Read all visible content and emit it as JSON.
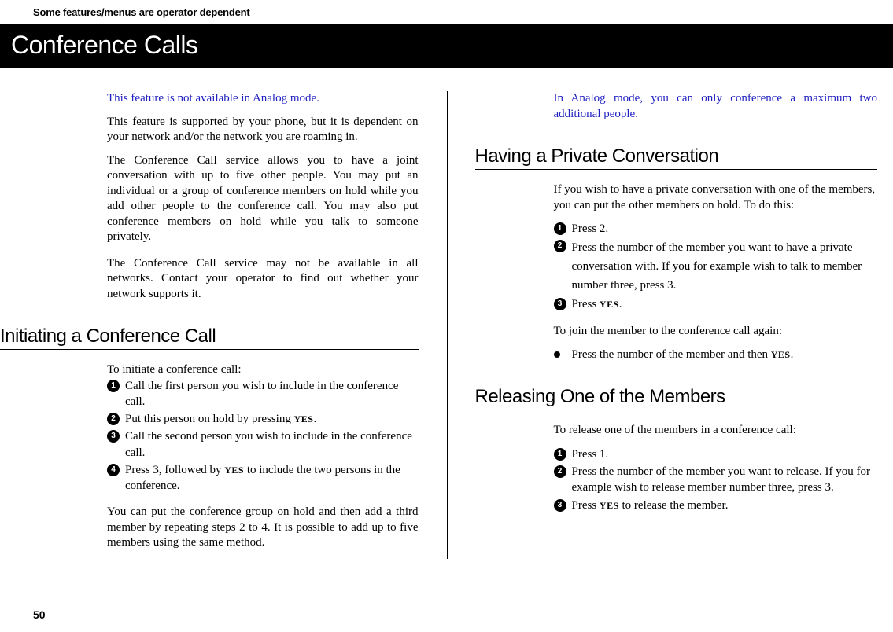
{
  "header_note": "Some features/menus are operator dependent",
  "title": "Conference Calls",
  "left": {
    "note1": "This feature is not available in Analog mode.",
    "para1": "This feature is supported by your phone, but it is dependent on your network and/or the network you are roaming in.",
    "para2": "The Conference Call service allows you to have a joint conversation with up to five other people. You may put an individual or a group of conference members on hold while you add other people to the conference call. You may also put conference members on hold while you talk to someone privately.",
    "para3": "The Conference Call service may not be available in all networks. Contact your operator to find out whether your network supports it.",
    "section1_title": "Initiating a Conference Call",
    "section1_intro": "To initiate a conference call:",
    "section1_steps": [
      "Call the first person you wish to include in the conference call.",
      "Put this person on hold by pressing ",
      "Call the second person you wish to include in the conference call.",
      "Press 3, followed by "
    ],
    "section1_step2_suffix": ".",
    "section1_step4_mid": " to include the two persons in the conference.",
    "section1_after": "You can put the conference group on hold and then add a third member by repeating steps 2 to 4. It is possible to add up to five members using the same method."
  },
  "right": {
    "note1": "In Analog mode, you can only conference a maximum two additional people.",
    "section1_title": "Having a Private Conversation",
    "section1_intro": "If you wish to have a private conversation with one of the members, you can put the other members on hold. To do this:",
    "section1_steps": [
      "Press 2.",
      "Press the number of the member you  want to have a private conversation with. If you for example wish to talk to member number three, press 3.",
      "Press "
    ],
    "section1_step3_suffix": ".",
    "section1_rejoin_intro": "To join the member to the conference call again:",
    "section1_rejoin_bullet_pre": "Press the number of the member and then ",
    "section1_rejoin_bullet_suf": ".",
    "section2_title": "Releasing One of the Members",
    "section2_intro": "To release one of the members in a conference call:",
    "section2_steps": [
      "Press 1.",
      "Press the number of the member you want to release. If you for example wish to release member number three, press 3.",
      "Press "
    ],
    "section2_step3_suffix": " to release the member."
  },
  "yes_key": "YES",
  "page_number": "50"
}
